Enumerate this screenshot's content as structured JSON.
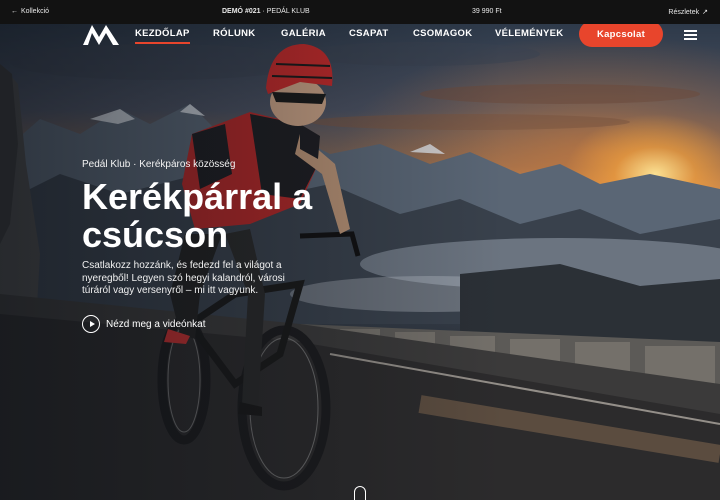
{
  "demo_bar": {
    "back_label": "Kollekció",
    "demo_prefix": "DEMÓ #021",
    "demo_name": "· PEDÁL KLUB",
    "price": "39 990 Ft",
    "details_label": "Részletek"
  },
  "nav": {
    "items": [
      {
        "label": "Kezdőlap",
        "active": true
      },
      {
        "label": "Rólunk"
      },
      {
        "label": "Galéria"
      },
      {
        "label": "Csapat"
      },
      {
        "label": "Csomagok"
      },
      {
        "label": "Vélemények"
      }
    ],
    "cta_label": "Kapcsolat"
  },
  "hero": {
    "eyebrow": "Pedál Klub · Kerékpáros közösség",
    "headline": "Kerékpárral a csúcson",
    "lead": "Csatlakozz hozzánk, és fedezd fel a világot a nyeregből! Legyen szó hegyi kalandról, városi túráról vagy versenyről – mi itt vagyunk.",
    "video_label": "Nézd meg a videónkat"
  },
  "colors": {
    "accent": "#e8452c",
    "demo_bar_bg": "#121212",
    "text": "#ffffff"
  },
  "icons": [
    "arrow-left-icon",
    "arrow-up-right-icon",
    "logo-mark",
    "menu-icon",
    "play-icon",
    "scroll-indicator-icon"
  ]
}
